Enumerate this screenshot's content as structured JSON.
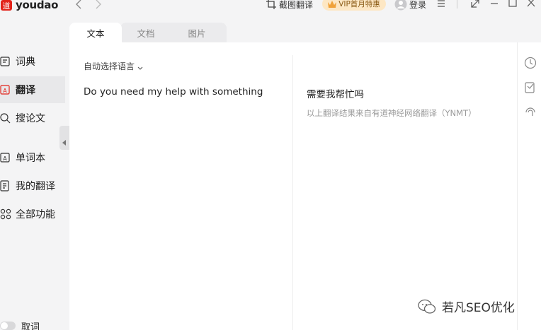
{
  "app": {
    "logo_text": "youdao",
    "logo_glyph": "道"
  },
  "titlebar": {
    "screenshot_translate_label": "截图翻译",
    "vip_label": "VIP首月特惠",
    "login_label": "登录",
    "accent_color": "#e2231a"
  },
  "sidebar": {
    "items": [
      {
        "label": "词典",
        "icon": "dictionary-icon"
      },
      {
        "label": "翻译",
        "icon": "translate-icon",
        "active": true
      },
      {
        "label": "搜论文",
        "icon": "search-paper-icon"
      },
      {
        "label": "单词本",
        "icon": "wordbook-icon"
      },
      {
        "label": "我的翻译",
        "icon": "my-translation-icon"
      },
      {
        "label": "全部功能",
        "icon": "all-features-icon"
      }
    ],
    "toggle_label": "取词"
  },
  "tabs": [
    {
      "label": "文本",
      "active": true
    },
    {
      "label": "文档",
      "active": false
    },
    {
      "label": "图片",
      "active": false
    }
  ],
  "source": {
    "language_select": "自动选择语言",
    "text": "Do you need my help with something"
  },
  "target": {
    "text": "需要我帮忙吗",
    "note": "以上翻译结果来自有道神经网络翻译（YNMT）"
  },
  "right_rail": [
    "history-icon",
    "feedback-icon",
    "voice-icon"
  ],
  "watermark": {
    "text": "若凡SEO优化"
  }
}
